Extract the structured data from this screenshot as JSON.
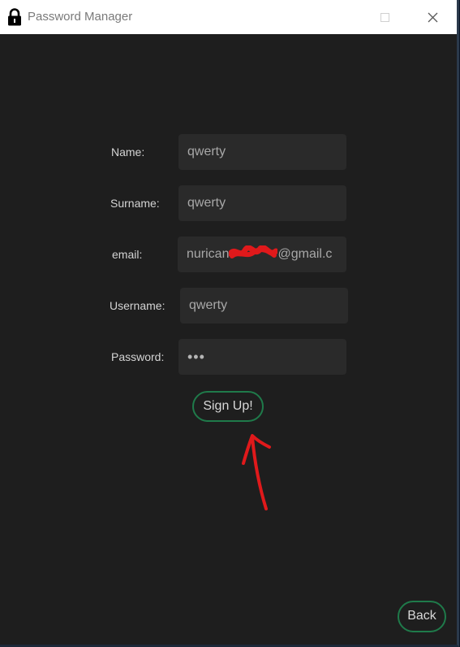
{
  "window": {
    "title": "Password Manager"
  },
  "form": {
    "name_label": "Name:",
    "name_value": "qwerty",
    "surname_label": "Surname:",
    "surname_value": "qwerty",
    "email_label": "email:",
    "email_value_prefix": "nurican",
    "email_value_suffix": "@gmail.c",
    "username_label": "Username:",
    "username_value": "qwerty",
    "password_label": "Password:",
    "password_value": "•••"
  },
  "buttons": {
    "signup_label": "Sign Up!",
    "back_label": "Back"
  },
  "colors": {
    "background": "#1e1e1e",
    "field": "#2a2a2a",
    "accent_border": "#1f7a4a",
    "annotation": "#e0191b"
  },
  "icons": {
    "app": "padlock-icon",
    "minimize": "minimize-icon",
    "maximize": "maximize-icon",
    "close": "close-icon"
  }
}
